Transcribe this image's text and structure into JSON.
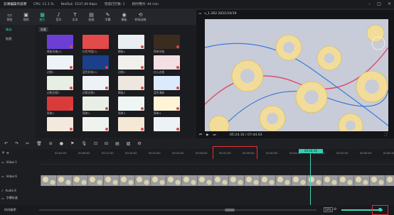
{
  "app": {
    "title": "云课编操作说明",
    "cpu": "CPU: 11.1 %",
    "netout": "NetOut: 1537.44 Kbps",
    "audiocount": "完成打打数: 1",
    "elapsed": "耗时用时: 44 min"
  },
  "toptools": [
    {
      "icon": "▭",
      "label": "预览"
    },
    {
      "icon": "▣",
      "label": "视频"
    },
    {
      "icon": "▦",
      "label": "图片"
    },
    {
      "icon": "♪",
      "label": "音乐"
    },
    {
      "icon": "T",
      "label": "文本"
    },
    {
      "icon": "▤",
      "label": "贴纸"
    },
    {
      "icon": "✎",
      "label": "字幕"
    },
    {
      "icon": "◉",
      "label": "模板"
    },
    {
      "icon": "⟲",
      "label": "转场动效"
    }
  ],
  "righttools": [
    {
      "icon": "?",
      "label": "帮助"
    },
    {
      "icon": "▭",
      "label": "快捷键"
    }
  ],
  "sidebar": [
    {
      "label": "精选"
    },
    {
      "label": "贴图"
    }
  ],
  "library": {
    "tag": "标题",
    "thumbs": [
      {
        "label": "模板风格(2)",
        "bg": "#6b3fd6"
      },
      {
        "label": "红色中国(1)",
        "bg": "#e34b4b"
      },
      {
        "label": "模板1",
        "bg": "#e9eef2"
      },
      {
        "label": "简单风格",
        "bg": "#3a2c1f"
      },
      {
        "label": "边框1",
        "bg": "#eef3f7"
      },
      {
        "label": "蓝色科技(1)",
        "bg": "#1b3f8a"
      },
      {
        "label": "边框2",
        "bg": "#f1f0ea"
      },
      {
        "label": "红心边框",
        "bg": "#f4dfe5"
      },
      {
        "label": "边框边框3",
        "bg": "#e7eee3"
      },
      {
        "label": "边框边框4",
        "bg": "#ecf2f5"
      },
      {
        "label": "模板2",
        "bg": "#efe6df"
      },
      {
        "label": "蓝色清新",
        "bg": "#dbeafd"
      },
      {
        "label": "简单1",
        "bg": "#d93a3a"
      },
      {
        "label": "简单2",
        "bg": "#e8efe6"
      },
      {
        "label": "简单3",
        "bg": "#eef5f3"
      },
      {
        "label": "简单4",
        "bg": "#fff4d6"
      },
      {
        "label": "",
        "bg": "#f3e9dc"
      },
      {
        "label": "",
        "bg": "#eef3ee"
      },
      {
        "label": "",
        "bg": "#f5e8d4"
      },
      {
        "label": "",
        "bg": "#edf2f7"
      }
    ]
  },
  "preview": {
    "title": "v_1.262 2021/10/19",
    "current_time": "05:24.16",
    "total_time": "07:44.03"
  },
  "ruler": {
    "ticks": [
      "00:04:00",
      "00:08:00",
      "00:12:00",
      "00:16:00",
      "00:20:00",
      "00:24:00",
      "00:28:00",
      "00:32:00",
      "00:36:00",
      "00:40:00",
      "00:44:00",
      "00:48:00",
      "00:52:00",
      "00:56:00",
      "00:60:00"
    ],
    "playhead_label": "05:24.16"
  },
  "tracks": [
    {
      "name": "Video 1"
    },
    {
      "name": "Video 6"
    },
    {
      "name": "Audio 6"
    },
    {
      "name": "字幕轨道"
    }
  ],
  "status": {
    "label": "时间缩率",
    "zoom": "50%"
  }
}
